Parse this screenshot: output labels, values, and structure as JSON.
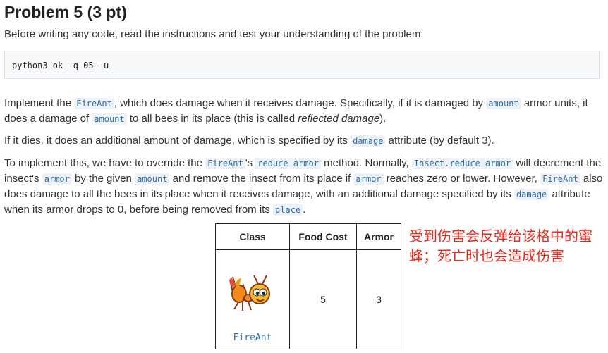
{
  "title": "Problem 5 (3 pt)",
  "intro": "Before writing any code, read the instructions and test your understanding of the problem:",
  "command": "python3 ok -q 05 -u",
  "p1": {
    "t1": "Implement the ",
    "c1": "FireAnt",
    "t2": ", which does damage when it receives damage. Specifically, if it is damaged by ",
    "c2": "amount",
    "t3": " armor units, it does a damage of ",
    "c3": "amount",
    "t4": " to all bees in its place (this is called ",
    "em": "reflected damage",
    "t5": ")."
  },
  "p2": {
    "t1": "If it dies, it does an additional amount of damage, which is specified by its ",
    "c1": "damage",
    "t2": " attribute (by default 3)."
  },
  "p3": {
    "t1": "To implement this, we have to override the ",
    "c1": "FireAnt",
    "t2": "'s ",
    "c2": "reduce_armor",
    "t3": " method. Normally, ",
    "c3": "Insect.reduce_armor",
    "t4": " will decrement the insect's ",
    "c4": "armor",
    "t5": " by the given ",
    "c5": "amount",
    "t6": " and remove the insect from its place if ",
    "c6": "armor",
    "t7": " reaches zero or lower. However, ",
    "c7": "FireAnt",
    "t8": " also does damage to all the bees in its place when it receives damage, with an additional damage specified by its ",
    "c8": "damage",
    "t9": " attribute when its armor drops to 0, before being removed from its ",
    "c9": "place",
    "t10": "."
  },
  "table": {
    "headers": [
      "Class",
      "Food Cost",
      "Armor"
    ],
    "row": {
      "name": "FireAnt",
      "food_cost": "5",
      "armor": "3"
    }
  },
  "note": "受到伤害会反弹给该格中的蜜蜂；死亡时也会造成伤害",
  "colors": {
    "code_text": "#2a6fb0",
    "note_red": "#e8291c"
  }
}
